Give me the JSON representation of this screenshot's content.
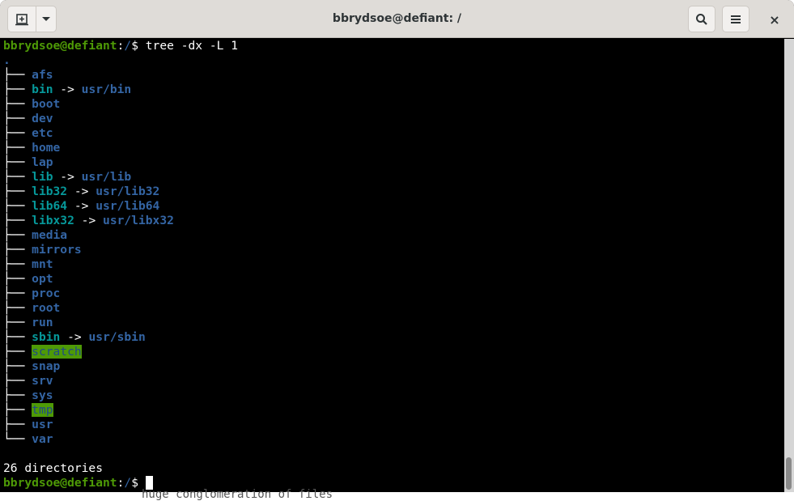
{
  "window": {
    "title": "bbrydsoe@defiant: /",
    "buttons": {
      "new_tab": "new-tab-icon",
      "tab_menu": "chevron-down-icon",
      "search": "search-icon",
      "menu": "hamburger-menu-icon",
      "close": "×"
    }
  },
  "terminal": {
    "prompt_user": "bbrydsoe@defiant",
    "prompt_sep": ":",
    "prompt_path": "/",
    "prompt_sym": "$ ",
    "command": "tree -dx -L 1",
    "root": ".",
    "entries": [
      {
        "branch": "├── ",
        "name": "afs",
        "type": "dir"
      },
      {
        "branch": "├── ",
        "name": "bin",
        "type": "link",
        "target": "usr/bin"
      },
      {
        "branch": "├── ",
        "name": "boot",
        "type": "dir"
      },
      {
        "branch": "├── ",
        "name": "dev",
        "type": "dir"
      },
      {
        "branch": "├── ",
        "name": "etc",
        "type": "dir"
      },
      {
        "branch": "├── ",
        "name": "home",
        "type": "dir"
      },
      {
        "branch": "├── ",
        "name": "lap",
        "type": "dir"
      },
      {
        "branch": "├── ",
        "name": "lib",
        "type": "link",
        "target": "usr/lib"
      },
      {
        "branch": "├── ",
        "name": "lib32",
        "type": "link",
        "target": "usr/lib32"
      },
      {
        "branch": "├── ",
        "name": "lib64",
        "type": "link",
        "target": "usr/lib64"
      },
      {
        "branch": "├── ",
        "name": "libx32",
        "type": "link",
        "target": "usr/libx32"
      },
      {
        "branch": "├── ",
        "name": "media",
        "type": "dir"
      },
      {
        "branch": "├── ",
        "name": "mirrors",
        "type": "dir"
      },
      {
        "branch": "├── ",
        "name": "mnt",
        "type": "dir"
      },
      {
        "branch": "├── ",
        "name": "opt",
        "type": "dir"
      },
      {
        "branch": "├── ",
        "name": "proc",
        "type": "dir"
      },
      {
        "branch": "├── ",
        "name": "root",
        "type": "dir"
      },
      {
        "branch": "├── ",
        "name": "run",
        "type": "dir"
      },
      {
        "branch": "├── ",
        "name": "sbin",
        "type": "link",
        "target": "usr/sbin"
      },
      {
        "branch": "├── ",
        "name": "scratch",
        "type": "sticky"
      },
      {
        "branch": "├── ",
        "name": "snap",
        "type": "dir"
      },
      {
        "branch": "├── ",
        "name": "srv",
        "type": "dir"
      },
      {
        "branch": "├── ",
        "name": "sys",
        "type": "dir"
      },
      {
        "branch": "├── ",
        "name": "tmp",
        "type": "sticky"
      },
      {
        "branch": "├── ",
        "name": "usr",
        "type": "dir"
      },
      {
        "branch": "└── ",
        "name": "var",
        "type": "dir"
      }
    ],
    "arrow": " -> ",
    "summary": "26 directories"
  },
  "background_text": "huge conglomeration of files"
}
